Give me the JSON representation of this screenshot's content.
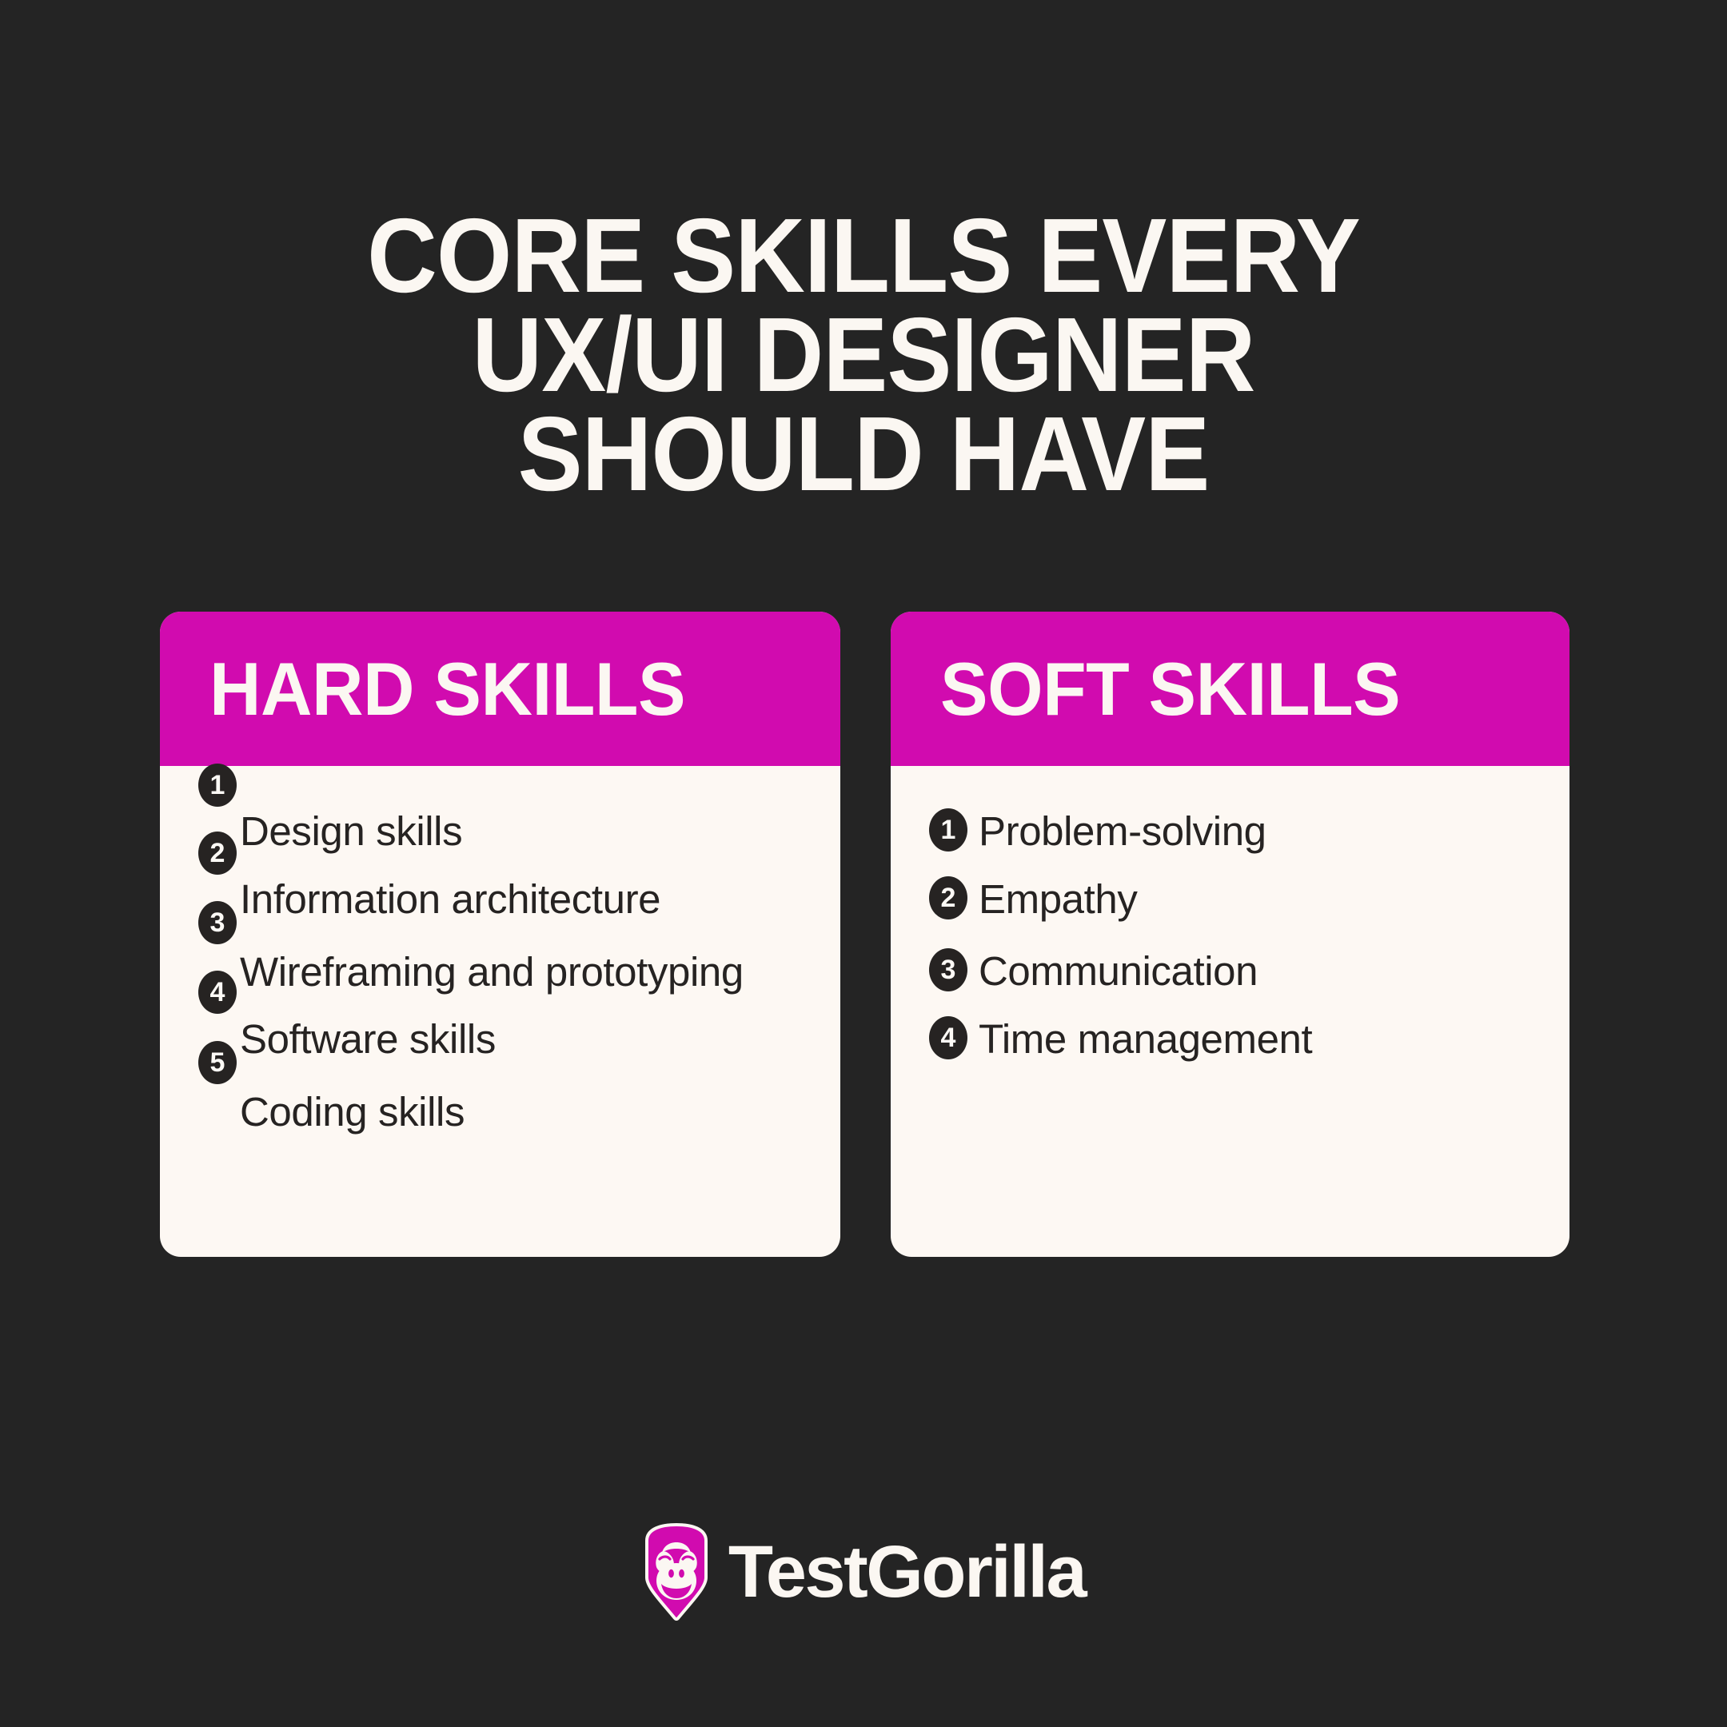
{
  "theme": {
    "background": "#242424",
    "accent_magenta": "#D10BAF",
    "card_body": "#FDF8F3",
    "text_light": "#FBF7F2",
    "text_dark": "#262322"
  },
  "title": {
    "line1": "Core skills every",
    "line2": "UX/UI designer",
    "line3": "should have"
  },
  "cards": [
    {
      "heading": "Hard skills",
      "items": [
        {
          "number": "1",
          "label": "Design skills"
        },
        {
          "number": "2",
          "label": "Information architecture"
        },
        {
          "number": "3",
          "label": "Wireframing and prototyping"
        },
        {
          "number": "4",
          "label": "Software skills"
        },
        {
          "number": "5",
          "label": "Coding skills"
        }
      ]
    },
    {
      "heading": "Soft skills",
      "items": [
        {
          "number": "1",
          "label": "Problem-solving"
        },
        {
          "number": "2",
          "label": "Empathy"
        },
        {
          "number": "3",
          "label": "Communication"
        },
        {
          "number": "4",
          "label": "Time management"
        }
      ]
    }
  ],
  "logo": {
    "icon": "gorilla-shield-icon",
    "wordmark": "TestGorilla"
  }
}
